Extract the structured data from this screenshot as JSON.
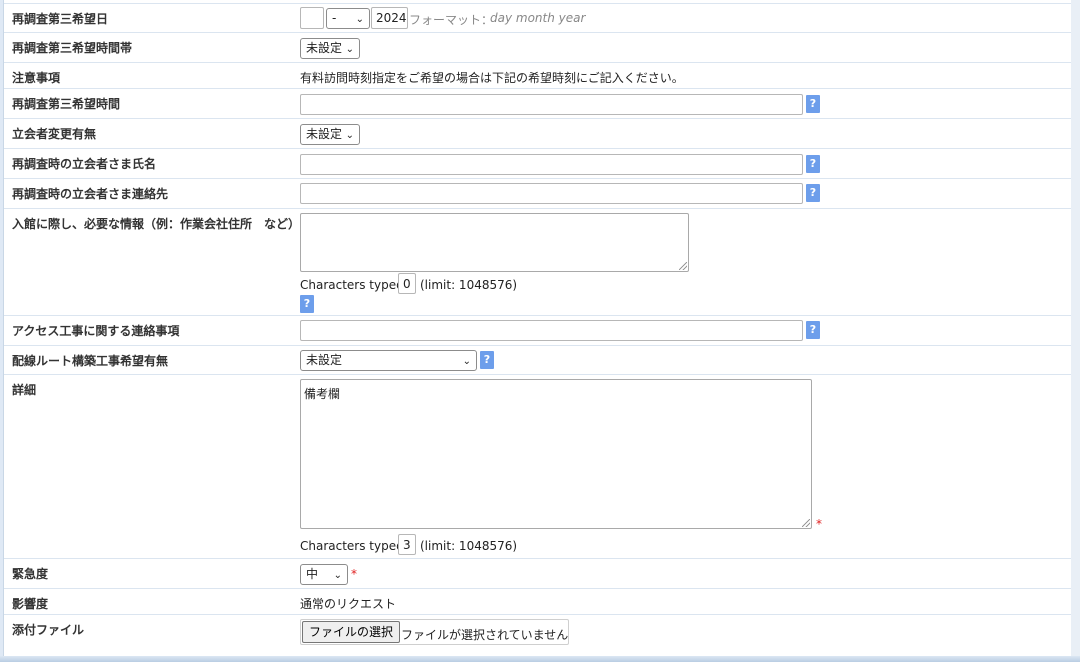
{
  "rows": {
    "third_date": {
      "label": "再調査第三希望日",
      "day": "",
      "month": "-",
      "year": "2024",
      "format_prefix": "フォーマット：",
      "format_value": "day month year"
    },
    "third_timeslot": {
      "label": "再調査第三希望時間帯",
      "value": "未設定"
    },
    "notice": {
      "label": "注意事項",
      "text": "有料訪問時刻指定をご希望の場合は下記の希望時刻にご記入ください。"
    },
    "third_time": {
      "label": "再調査第三希望時間",
      "value": ""
    },
    "attendee_change": {
      "label": "立会者変更有無",
      "value": "未設定"
    },
    "attendee_name": {
      "label": "再調査時の立会者さま氏名",
      "value": ""
    },
    "attendee_contact": {
      "label": "再調査時の立会者さま連絡先",
      "value": ""
    },
    "entry_info": {
      "label": "入館に際し、必要な情報（例：作業会社住所　など）",
      "value": "",
      "counter_label": "Characters typed:",
      "count": "0",
      "limit": "(limit: 1048576)"
    },
    "access_work": {
      "label": "アクセス工事に関する連絡事項",
      "value": ""
    },
    "wiring_route": {
      "label": "配線ルート構築工事希望有無",
      "value": "未設定"
    },
    "details": {
      "label": "詳細",
      "value": "備考欄",
      "counter_label": "Characters typed:",
      "count": "3",
      "limit": "(limit: 1048576)"
    },
    "urgency": {
      "label": "緊急度",
      "value": "中"
    },
    "impact": {
      "label": "影響度",
      "text": "通常のリクエスト"
    },
    "attachment": {
      "label": "添付ファイル",
      "button": "ファイルの選択",
      "status": "ファイルが選択されていません"
    }
  },
  "help_glyph": "?",
  "required_mark": "*",
  "select_arrow": "⌄",
  "colors": {
    "help": "#6d9eeb",
    "required": "#e02020",
    "row_border": "#dbe5f0"
  }
}
